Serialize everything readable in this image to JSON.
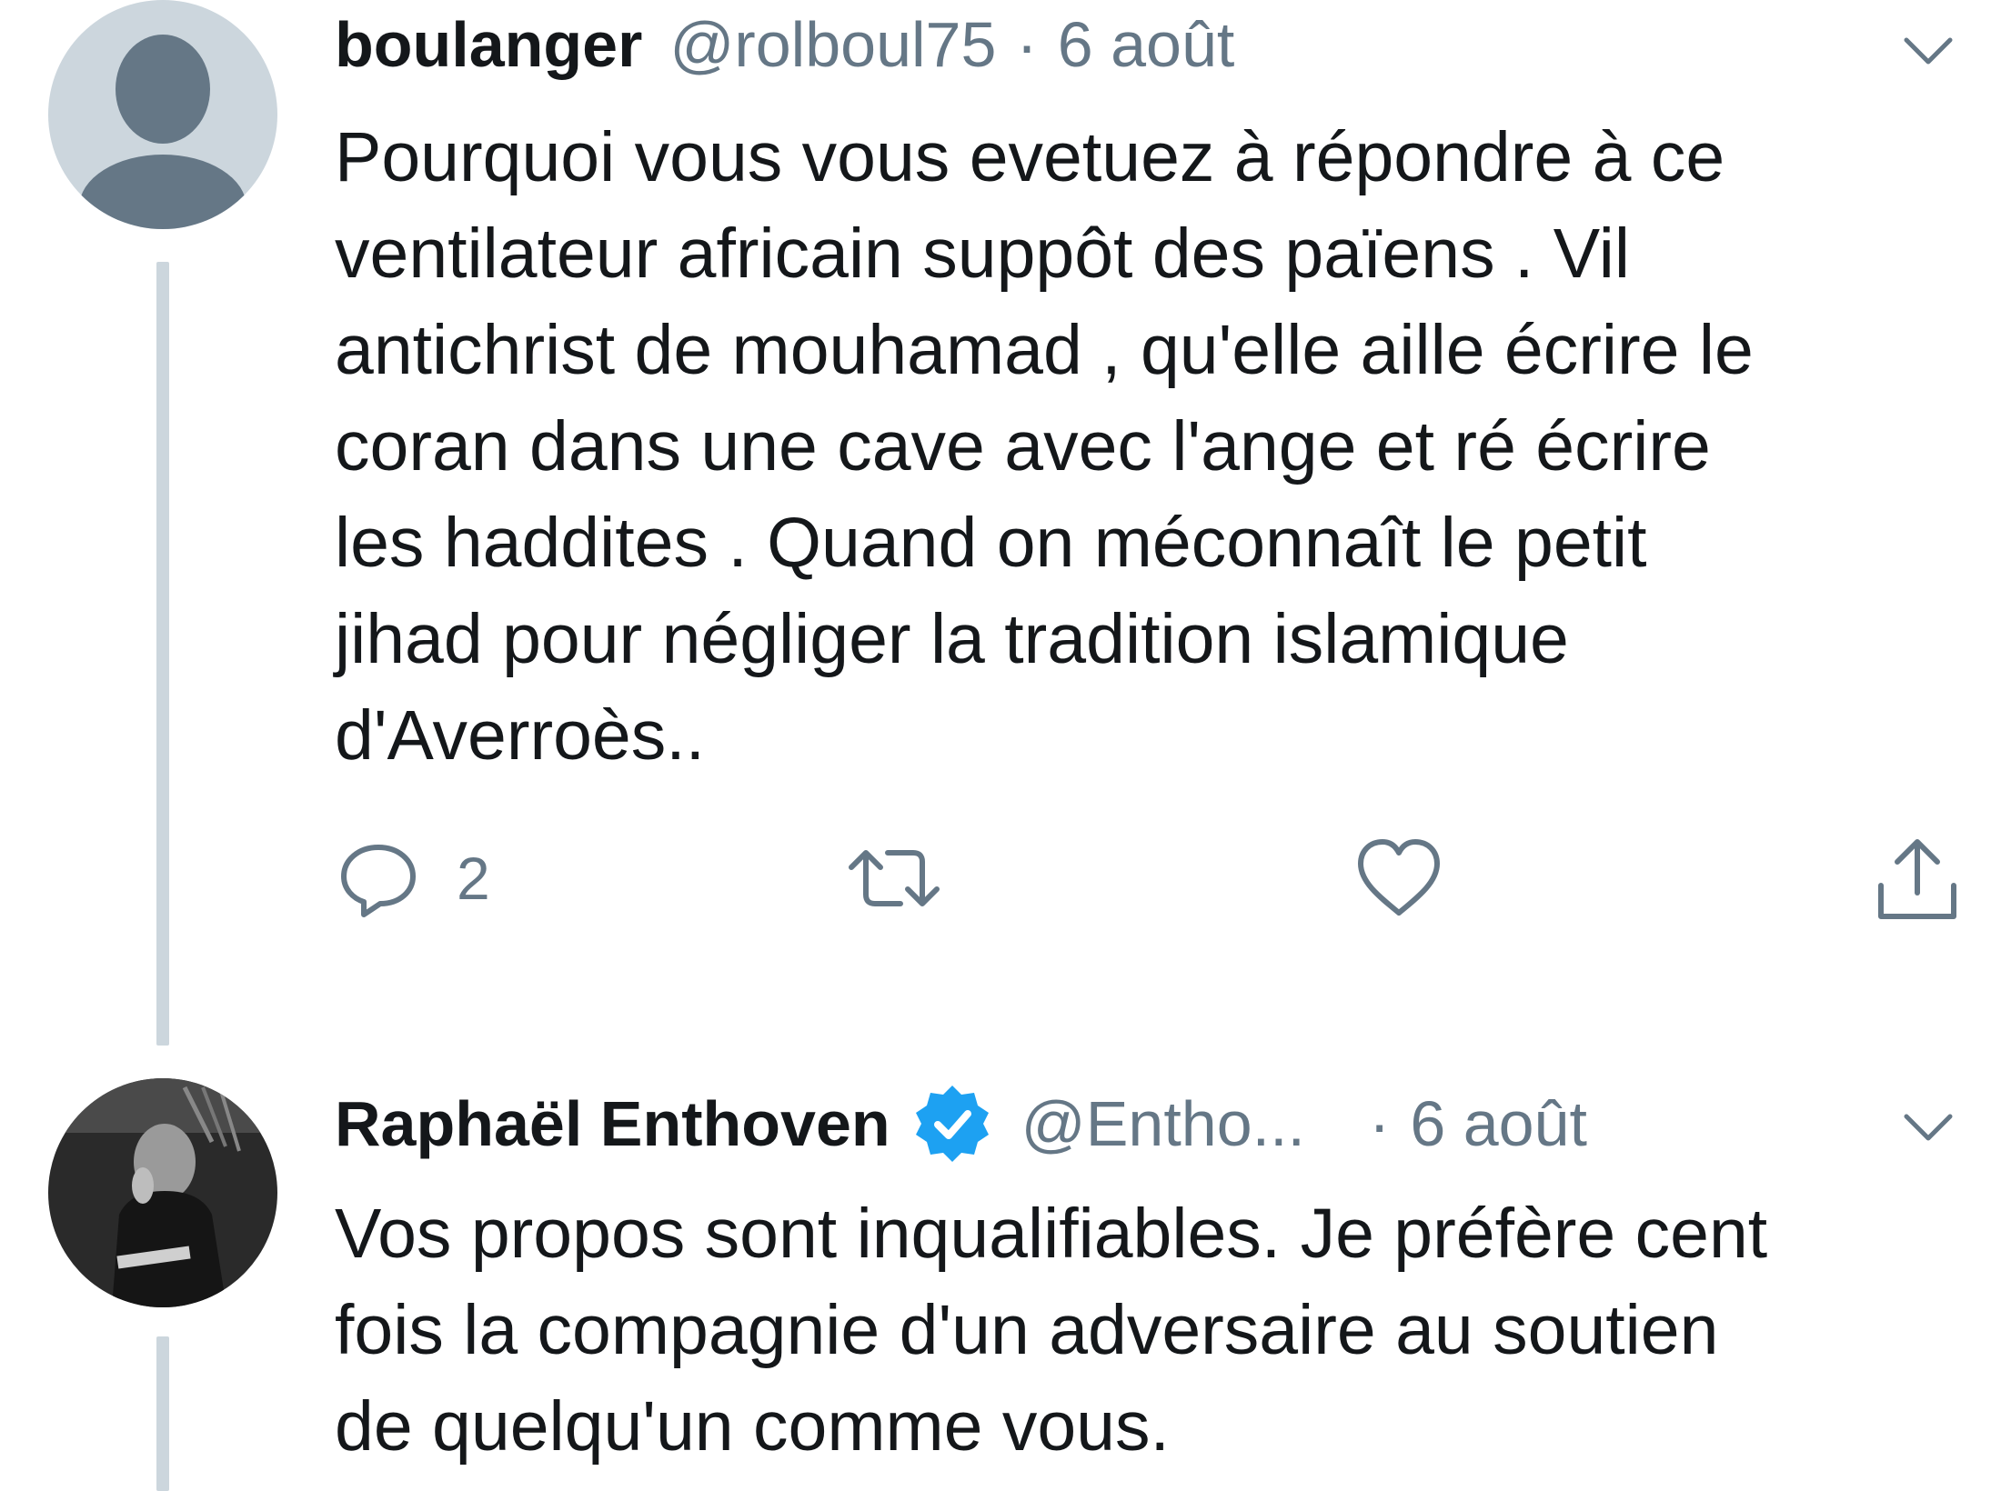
{
  "tweets": [
    {
      "display_name": "boulanger",
      "handle": "@rolboul75",
      "separator": "·",
      "date": "6 août",
      "verified": false,
      "avatar_icon": "default-profile-icon",
      "text": "Pourquoi vous vous evetuez à répondre à ce\nventilateur africain suppôt des païens . Vil\nantichrist de mouhamad , qu'elle aille écrire le\ncoran dans une cave avec l'ange et ré écrire\nles haddites . Quand on méconnaît le petit\njihad pour négliger la tradition islamique\nd'Averroès..",
      "actions": {
        "reply_count": "2",
        "reply_icon": "reply-icon",
        "retweet_icon": "retweet-icon",
        "like_icon": "heart-icon",
        "share_icon": "share-icon"
      }
    },
    {
      "display_name": "Raphaël Enthoven",
      "handle": "@Entho...",
      "separator": "·",
      "date": "6 août",
      "verified": true,
      "avatar_icon": "profile-photo",
      "text": "Vos propos sont inqualifiables. Je préfère cent\nfois la compagnie d'un adversaire au soutien\nde quelqu'un comme vous."
    }
  ],
  "colors": {
    "text_primary": "#14171a",
    "text_secondary": "#657786",
    "verified_blue": "#1da1f2",
    "thread_line": "#ccd6dd",
    "avatar_default_bg": "#ccd6dd",
    "avatar_default_fg": "#657786"
  }
}
